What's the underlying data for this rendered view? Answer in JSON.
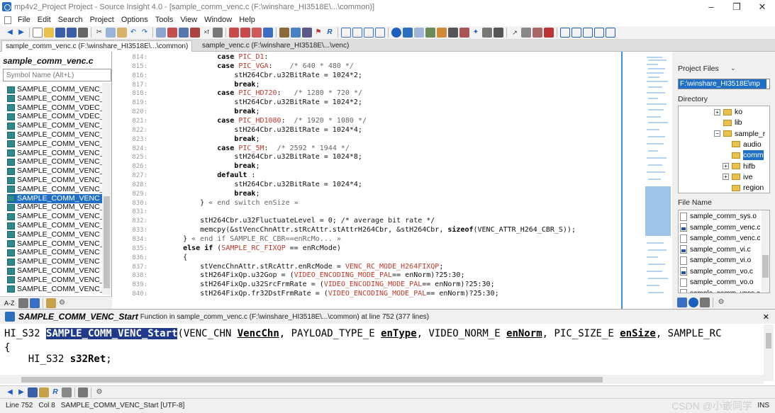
{
  "window": {
    "title": "mp4v2_Project Project - Source Insight 4.0 - [sample_comm_venc.c (F:\\winshare_HI3518E\\...\\common)]",
    "controls": [
      "–",
      "❐",
      "✕"
    ]
  },
  "menu": [
    "File",
    "Edit",
    "Search",
    "Project",
    "Options",
    "Tools",
    "View",
    "Window",
    "Help"
  ],
  "tabs": [
    "sample_comm_venc.c (F:\\winshare_HI3518E\\...\\common)",
    "sample_venc.c (F:\\winshare_HI3518E\\...\\venc)"
  ],
  "symbol_window": {
    "file_name": "sample_comm_venc.c",
    "search_placeholder": "Symbol Name (Alt+L)",
    "items": [
      "SAMPLE_COMM_VENC_",
      "SAMPLE_COMM_VENC_",
      "SAMPLE_COMM_VDEC_",
      "SAMPLE_COMM_VDEC_",
      "SAMPLE_COMM_VENC_",
      "SAMPLE_COMM_VENC_",
      "SAMPLE_COMM_VENC_",
      "SAMPLE_COMM_VENC_",
      "SAMPLE_COMM_VENC_",
      "SAMPLE_COMM_VENC_",
      "SAMPLE_COMM_VENC_",
      "SAMPLE_COMM_VENC_",
      "SAMPLE_COMM_VENC",
      "SAMPLE_COMM_VENC_",
      "SAMPLE_COMM_VENC_",
      "SAMPLE_COMM_VENC_",
      "SAMPLE_COMM_VENC",
      "SAMPLE_COMM_VENC_",
      "SAMPLE_COMM_VENC",
      "SAMPLE_COMM_VENC",
      "SAMPLE_COMM_VENC",
      "SAMPLE_COMM_VENC_",
      "SAMPLE_COMM_VENC_",
      "SAMPLE_COMM_VENC_"
    ],
    "selected_index": 12,
    "bottom_label": "A-Z"
  },
  "editor": {
    "lines": [
      {
        "n": "814:",
        "html": "            <span class='kw'>case</span> <span class='mac'>PIC_D1</span>:"
      },
      {
        "n": "815:",
        "html": "            <span class='kw'>case</span> <span class='mac'>PIC_VGA</span>:    <span class='cm'>/* 640 * 480 */</span>"
      },
      {
        "n": "816:",
        "html": "                stH264Cbr.u32BitRate = 1024*2;"
      },
      {
        "n": "817:",
        "html": "                <span class='kw'>break</span>;"
      },
      {
        "n": "818:",
        "html": "            <span class='kw'>case</span> <span class='mac'>PIC_HD720</span>:   <span class='cm'>/* 1280 * 720 */</span>"
      },
      {
        "n": "819:",
        "html": "                stH264Cbr.u32BitRate = 1024*2;"
      },
      {
        "n": "820:",
        "html": "                <span class='kw'>break</span>;"
      },
      {
        "n": "821:",
        "html": "            <span class='kw'>case</span> <span class='mac'>PIC_HD1080</span>:  <span class='cm'>/* 1920 * 1080 */</span>"
      },
      {
        "n": "822:",
        "html": "                stH264Cbr.u32BitRate = 1024*4;"
      },
      {
        "n": "823:",
        "html": "                <span class='kw'>break</span>;"
      },
      {
        "n": "824:",
        "html": "            <span class='kw'>case</span> <span class='mac'>PIC_5M</span>:  <span class='cm'>/* 2592 * 1944 */</span>"
      },
      {
        "n": "825:",
        "html": "                stH264Cbr.u32BitRate = 1024*8;"
      },
      {
        "n": "826:",
        "html": "                <span class='kw'>break</span>;"
      },
      {
        "n": "827:",
        "html": "            <span class='kw'>default</span> :"
      },
      {
        "n": "828:",
        "html": "                stH264Cbr.u32BitRate = 1024*4;"
      },
      {
        "n": "829:",
        "html": "                <span class='kw'>break</span>;"
      },
      {
        "n": "830:",
        "html": "        } <span class='cm'>« end switch enSize »</span>"
      },
      {
        "n": "831:",
        "html": ""
      },
      {
        "n": "832:",
        "html": "        stH264Cbr.u32FluctuateLevel = 0; <span class='str'>/* average bit rate */</span>"
      },
      {
        "n": "833:",
        "html": "        memcpy(&amp;stVencChnAttr.stRcAttr.stAttrH264Cbr, &amp;stH264Cbr, <span class='kw'>sizeof</span>(VENC_ATTR_H264_CBR_S));"
      },
      {
        "n": "834:",
        "html": "    } <span class='cm'>« end if SAMPLE_RC_CBR==enRcMo... »</span>"
      },
      {
        "n": "835:",
        "html": "    <span class='kw'>else if</span> (<span class='mac'>SAMPLE_RC_FIXQP</span> == enRcMode)"
      },
      {
        "n": "836:",
        "html": "    {"
      },
      {
        "n": "837:",
        "html": "        stVencChnAttr.stRcAttr.enRcMode = <span class='mac'>VENC_RC_MODE_H264FIXQP</span>;"
      },
      {
        "n": "838:",
        "html": "        stH264FixQp.u32Gop = (<span class='mac'>VIDEO_ENCODING_MODE_PAL</span>== enNorm)?25:30;"
      },
      {
        "n": "839:",
        "html": "        stH264FixQp.u32SrcFrmRate = (<span class='mac'>VIDEO_ENCODING_MODE_PAL</span>== enNorm)?25:30;"
      },
      {
        "n": "840:",
        "html": "        stH264FixQp.fr32DstFrmRate = (<span class='mac'>VIDEO_ENCODING_MODE_PAL</span>== enNorm)?25:30;"
      }
    ]
  },
  "project_files": {
    "label": "Project Files",
    "path": "F:\\winshare_HI3518E\\mp",
    "directory_label": "Directory",
    "dirs": [
      {
        "name": "ko",
        "expander": "+",
        "indent": 0
      },
      {
        "name": "lib",
        "expander": "",
        "indent": 0
      },
      {
        "name": "sample_r",
        "expander": "−",
        "indent": 0
      },
      {
        "name": "audio",
        "expander": "",
        "indent": 1
      },
      {
        "name": "comm",
        "expander": "",
        "indent": 1,
        "selected": true
      },
      {
        "name": "hifb",
        "expander": "+",
        "indent": 1
      },
      {
        "name": "ive",
        "expander": "+",
        "indent": 1
      },
      {
        "name": "region",
        "expander": "",
        "indent": 1
      }
    ],
    "file_name_label": "File Name",
    "files": [
      {
        "name": "sample_comm_sys.o",
        "icon": "plain"
      },
      {
        "name": "sample_comm_venc.c",
        "icon": "blue"
      },
      {
        "name": "sample_comm_venc.c",
        "icon": "plain"
      },
      {
        "name": "sample_comm_vi.c",
        "icon": "blue"
      },
      {
        "name": "sample_comm_vi.o",
        "icon": "plain"
      },
      {
        "name": "sample_comm_vo.c",
        "icon": "blue"
      },
      {
        "name": "sample_comm_vo.o",
        "icon": "plain"
      },
      {
        "name": "sample_comm_vpss.c",
        "icon": "blue"
      }
    ]
  },
  "context": {
    "symbol": "SAMPLE_COMM_VENC_Start",
    "info": "Function in sample_comm_venc.c (F:\\winshare_HI3518E\\...\\common) at line 752 (377 lines)",
    "close": "✕"
  },
  "status": {
    "line": "Line 752",
    "col": "Col 8",
    "symbol": "SAMPLE_COMM_VENC_Start [UTF-8]",
    "watermark": "CSDN @小嵌同学",
    "mode": "INS"
  },
  "colors": {
    "selection": "#1f6fc7",
    "macro": "#c0392b",
    "highlight": "#1f3a8a"
  }
}
